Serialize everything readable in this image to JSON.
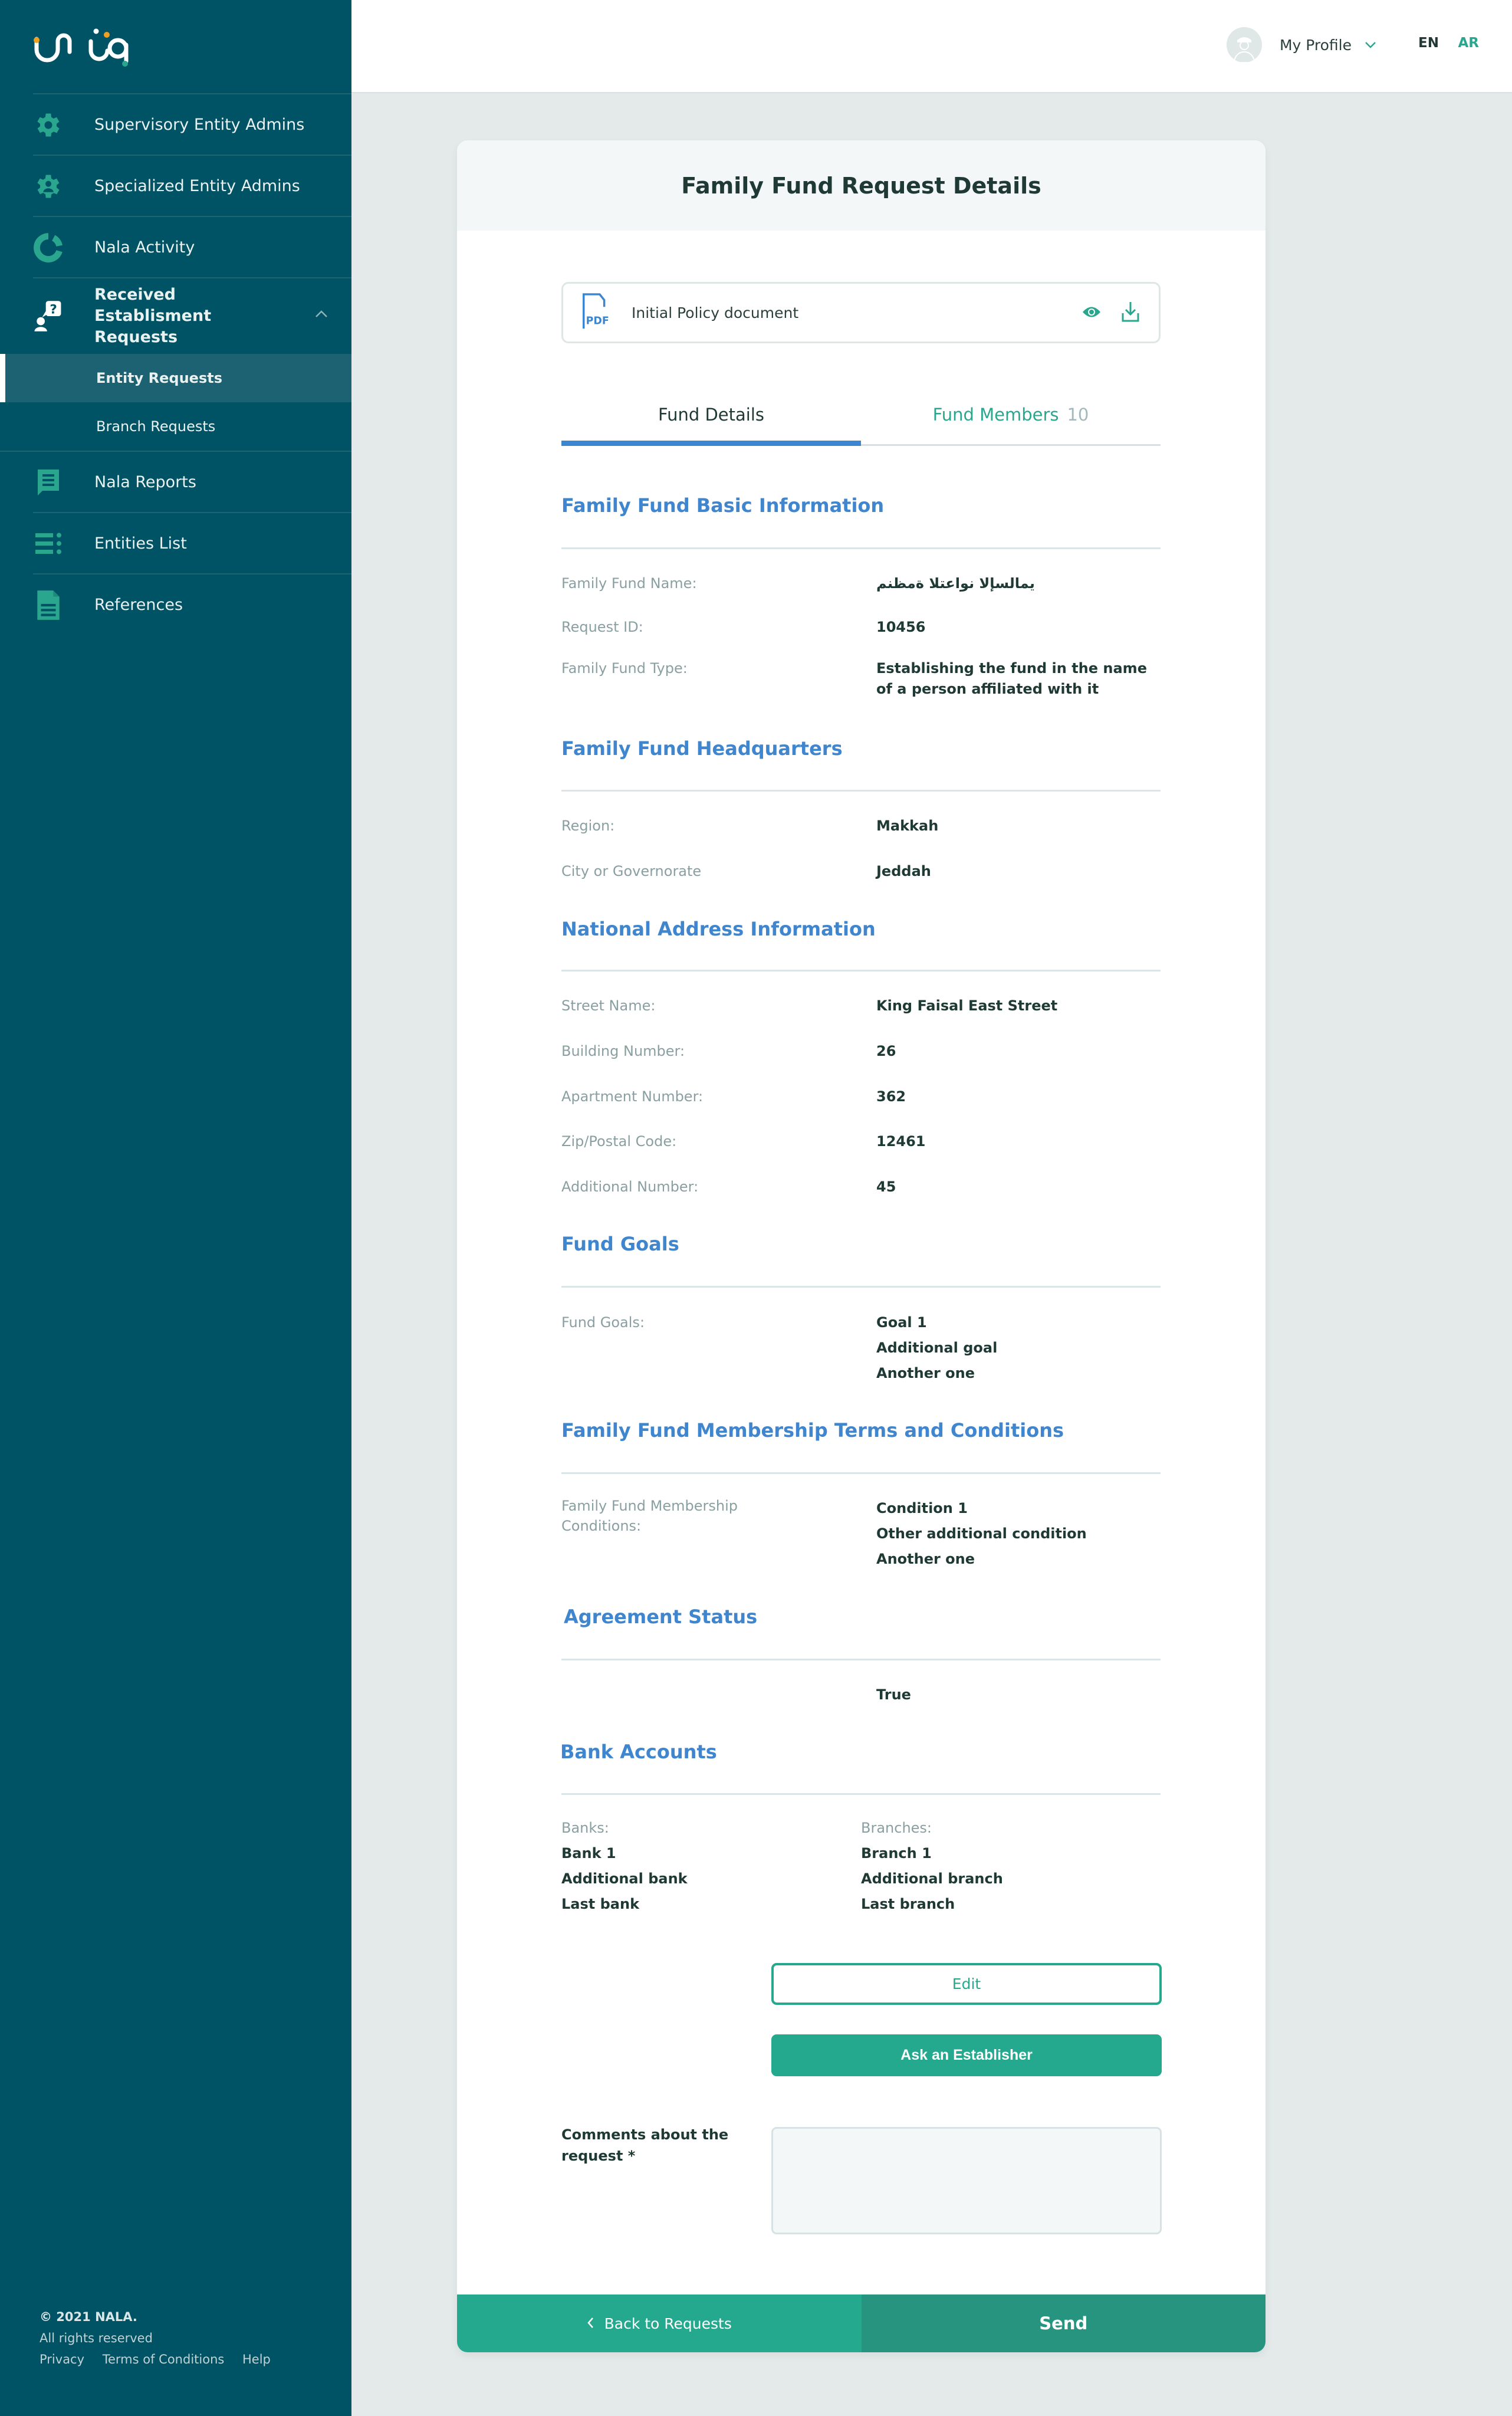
{
  "app": {
    "brand": "Nala",
    "logo_text": "نالا"
  },
  "sidebar": {
    "items": [
      {
        "label": "Supervisory Entity Admins",
        "icon": "gear-icon"
      },
      {
        "label": "Specialized Entity Admins",
        "icon": "gear-user-icon"
      },
      {
        "label": "Nala Activity",
        "icon": "donut-chart-icon"
      },
      {
        "label": "Received Establisment Requests",
        "icon": "user-question-icon",
        "expanded": true,
        "children": [
          {
            "label": "Entity Requests",
            "active": true
          },
          {
            "label": "Branch Requests",
            "active": false
          }
        ]
      },
      {
        "label": "Nala Reports",
        "icon": "report-chat-icon"
      },
      {
        "label": "Entities List",
        "icon": "list-icon"
      },
      {
        "label": "References",
        "icon": "document-icon"
      }
    ],
    "footer": {
      "copyright": "© 2021 NALA.",
      "rights": "All rights reserved",
      "links": [
        "Privacy",
        "Terms of Conditions",
        "Help"
      ]
    }
  },
  "header": {
    "profile_label": "My Profile",
    "lang_en": "EN",
    "lang_ar": "AR"
  },
  "colors": {
    "sidebar_bg": "#005364",
    "accent_green": "#24a88e",
    "section_blue": "#3f86cf",
    "page_bg": "#e4eaea"
  },
  "card": {
    "title": "Family Fund Request Details",
    "document": {
      "name": "Initial Policy document",
      "type": "PDF"
    },
    "tabs": [
      {
        "label": "Fund Details",
        "active": true
      },
      {
        "label": "Fund Members",
        "count": "10",
        "active": false
      }
    ],
    "sections": {
      "basic": {
        "title": "Family Fund Basic Information",
        "fields": [
          {
            "label": "Family Fund Name:",
            "value": "يمالسإلا نواعتلا ةمظنم"
          },
          {
            "label": "Request ID:",
            "value": "10456"
          },
          {
            "label": "Family Fund Type:",
            "value": "Establishing the fund in the name of a person affiliated with it"
          }
        ]
      },
      "hq": {
        "title": "Family Fund Headquarters",
        "fields": [
          {
            "label": "Region:",
            "value": "Makkah"
          },
          {
            "label": "City or Governorate",
            "value": "Jeddah"
          }
        ]
      },
      "address": {
        "title": "National Address Information",
        "fields": [
          {
            "label": "Street Name:",
            "value": "King Faisal East Street"
          },
          {
            "label": "Building Number:",
            "value": "26"
          },
          {
            "label": "Apartment Number:",
            "value": "362"
          },
          {
            "label": "Zip/Postal Code:",
            "value": "12461"
          },
          {
            "label": "Additional Number:",
            "value": "45"
          }
        ]
      },
      "goals": {
        "title": "Fund Goals",
        "label": "Fund Goals:",
        "values": [
          "Goal 1",
          "Additional goal",
          "Another one"
        ]
      },
      "terms": {
        "title": "Family Fund Membership Terms and Conditions",
        "label": "Family Fund Membership Conditions:",
        "values": [
          "Condition 1",
          "Other additional condition",
          "Another one"
        ]
      },
      "agreement": {
        "title": "Agreement Status",
        "value": "True"
      },
      "banks": {
        "title": "Bank Accounts",
        "banks_label": "Banks:",
        "banks": [
          "Bank 1",
          "Additional bank",
          "Last bank"
        ],
        "branches_label": "Branches:",
        "branches": [
          "Branch 1",
          "Additional branch",
          "Last branch"
        ]
      }
    },
    "edit_label": "Edit",
    "ask_label": "Ask an Establisher",
    "comments_label": "Comments about the request *",
    "comments_value": "",
    "back_label": "Back to Requests",
    "send_label": "Send"
  }
}
